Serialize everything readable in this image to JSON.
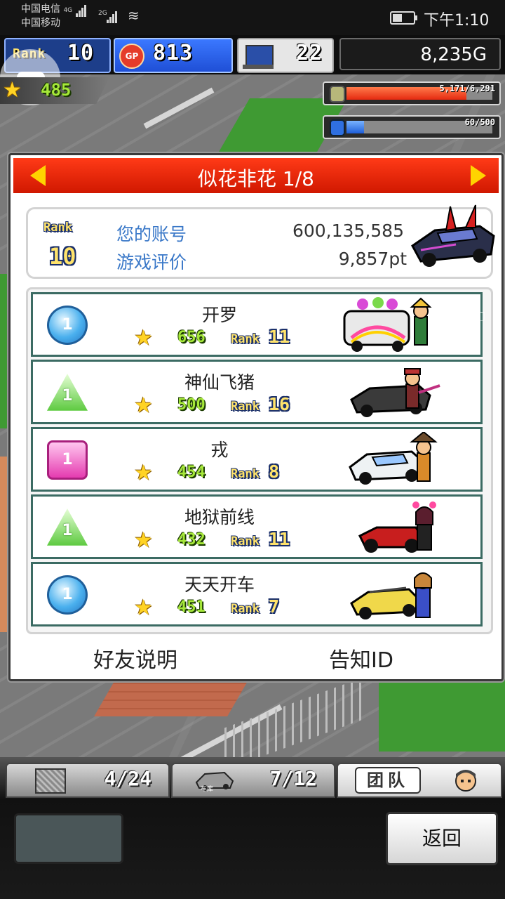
{
  "status_bar": {
    "carrier1": "中国电信",
    "net1": "4G",
    "carrier2": "中国移动",
    "net2": "2G",
    "time": "下午1:10"
  },
  "hud": {
    "rank_label": "Rank",
    "rank_value": "10",
    "gp_label": "GP",
    "gp_value": "813",
    "pc_value": "22",
    "money": "8,235G",
    "stars": "485",
    "meter1_text": "5,171/6,291",
    "meter1_fill": 0.82,
    "meter2_text": "60/500",
    "meter2_fill": 0.12
  },
  "panel": {
    "title": "似花非花 1/8",
    "rank_label": "Rank",
    "rank_value": "10",
    "account_label": "您的账号",
    "account_value": "600,135,585",
    "rating_label": "游戏评价",
    "rating_value": "9,857pt",
    "friends": [
      {
        "badge": "1",
        "shape": "circle",
        "name": "开罗",
        "points": "656",
        "rank_label": "Rank",
        "rank": "11"
      },
      {
        "badge": "1",
        "shape": "triangle",
        "name": "神仙飞猪",
        "points": "500",
        "rank_label": "Rank",
        "rank": "16"
      },
      {
        "badge": "1",
        "shape": "square",
        "name": "戎",
        "points": "454",
        "rank_label": "Rank",
        "rank": "8"
      },
      {
        "badge": "1",
        "shape": "triangle",
        "name": "地狱前线",
        "points": "432",
        "rank_label": "Rank",
        "rank": "11"
      },
      {
        "badge": "1",
        "shape": "circle",
        "name": "天天开车",
        "points": "451",
        "rank_label": "Rank",
        "rank": "7"
      }
    ],
    "friend_help": "好友说明",
    "notify_id": "告知ID"
  },
  "bottom": {
    "tab1_count": "4/24",
    "tab2_label": "车库",
    "tab2_count": "7/12",
    "tab3_label": "团队",
    "return_label": "返回"
  },
  "colors": {
    "header_red": "#e12a0a",
    "label_blue": "#3a78c8",
    "row_border": "#3b6b63",
    "points_green": "#a6e83a",
    "rank_yellow": "#ffe36b"
  }
}
